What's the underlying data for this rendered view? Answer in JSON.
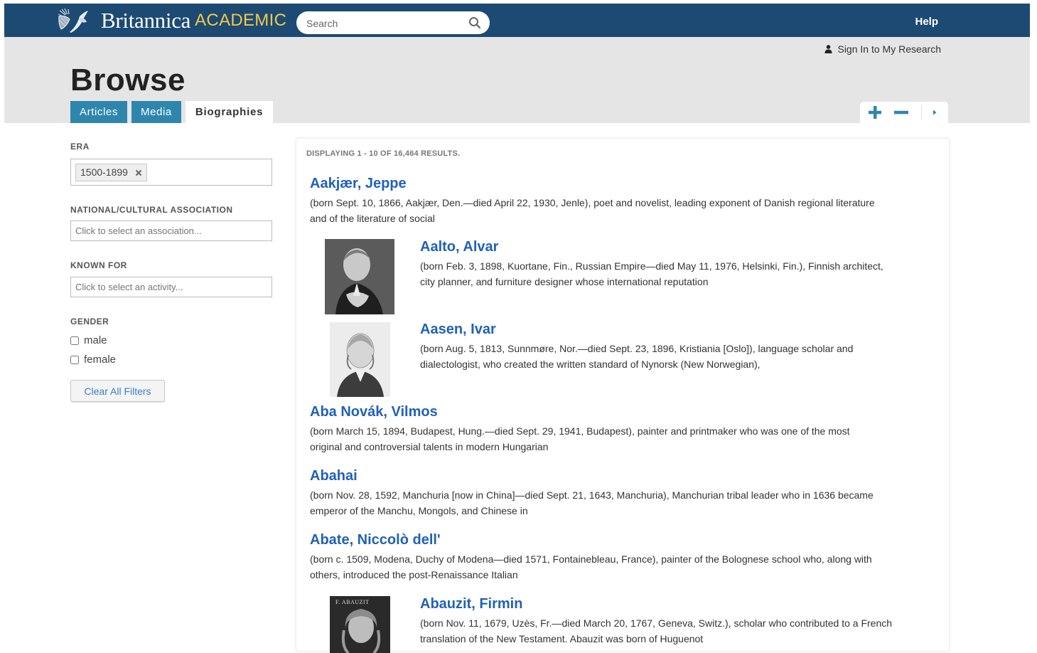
{
  "header": {
    "brand": "Britannica",
    "brand_sub": "ACADEMIC",
    "search_placeholder": "Search",
    "help": "Help",
    "sign_in": "Sign In to My Research"
  },
  "page": {
    "title": "Browse",
    "tabs": [
      {
        "label": "Articles",
        "active": false
      },
      {
        "label": "Media",
        "active": false
      },
      {
        "label": "Biographies",
        "active": true
      }
    ]
  },
  "filters": {
    "era": {
      "label": "ERA",
      "selected": "1500-1899"
    },
    "association": {
      "label": "NATIONAL/CULTURAL ASSOCIATION",
      "placeholder": "Click to select an association..."
    },
    "known_for": {
      "label": "KNOWN FOR",
      "placeholder": "Click to select an activity..."
    },
    "gender": {
      "label": "GENDER",
      "options": [
        "male",
        "female"
      ]
    },
    "clear": "Clear All Filters"
  },
  "results": {
    "count_text": "DISPLAYING 1 - 10 OF 16,464 RESULTS.",
    "items": [
      {
        "name": "Aakjær, Jeppe",
        "desc_line1": "(born Sept. 10, 1866, Aakjær, Den.—died April 22, 1930, Jenle), poet and novelist, leading exponent of Danish regional literature",
        "desc_line2": "and of the literature of social"
      },
      {
        "name": "Aalto, Alvar",
        "desc_line1": "(born Feb. 3, 1898, Kuortane, Fin., Russian Empire—died May 11, 1976, Helsinki, Fin.), Finnish architect,",
        "desc_line2": "city planner, and furniture designer whose international reputation"
      },
      {
        "name": "Aasen, Ivar",
        "desc_line1": "(born Aug. 5, 1813, Sunnmøre, Nor.—died Sept. 23, 1896, Kristiania [Oslo]), language scholar and",
        "desc_line2": "dialectologist, who created the written standard of Nynorsk (New Norwegian),"
      },
      {
        "name": "Aba Novák, Vilmos",
        "desc_line1": "(born March 15, 1894, Budapest, Hung.—died Sept. 29, 1941, Budapest), painter and printmaker who was one of the most",
        "desc_line2": "original and controversial talents in modern Hungarian"
      },
      {
        "name": "Abahai",
        "desc_line1": "(born Nov. 28, 1592, Manchuria [now in China]—died Sept. 21, 1643, Manchuria), Manchurian tribal leader who in 1636 became",
        "desc_line2": "emperor of the Manchu, Mongols, and Chinese in"
      },
      {
        "name": "Abate, Niccolò dell'",
        "desc_line1": "(born c. 1509, Modena, Duchy of Modena—died 1571, Fontainebleau, France), painter of the Bolognese school who, along with",
        "desc_line2": "others, introduced the post-Renaissance Italian"
      },
      {
        "name": "Abauzit, Firmin",
        "desc_line1": "(born Nov. 11, 1679, Uzès, Fr.—died March 20, 1767, Geneva, Switz.), scholar who contributed to a French",
        "desc_line2": "translation of the New Testament. Abauzit was born of Huguenot",
        "thumb_caption": "F. ABAUZIT"
      }
    ]
  },
  "icons": {
    "search": "search-icon",
    "user": "user-icon",
    "zoom_in": "plus-icon",
    "zoom_out": "minus-icon",
    "next": "caret-right-icon",
    "remove": "close-icon"
  },
  "colors": {
    "topbar": "#1c4a73",
    "tab": "#2e86ad",
    "link": "#2161b6",
    "brand_sub": "#f2c94c"
  }
}
